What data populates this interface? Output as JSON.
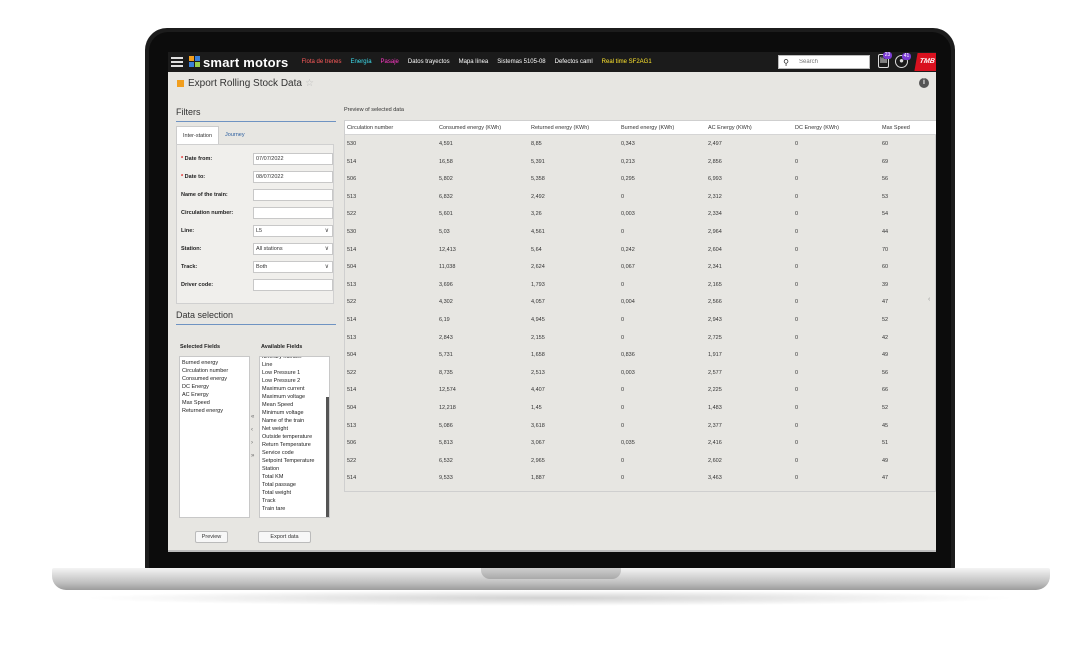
{
  "nav": {
    "logo_text": "smart motors",
    "items": [
      {
        "label": "Flota de trenes",
        "color": "#ff5b5b",
        "bar": ""
      },
      {
        "label": "Energía",
        "color": "#3ee0f0",
        "bar": ""
      },
      {
        "label": "Pasaje",
        "color": "#ff39c7",
        "bar": ""
      },
      {
        "label": "Datos trayectos",
        "color": "#ffffff",
        "bar": "#d63b3b"
      },
      {
        "label": "Mapa línea",
        "color": "#ffffff",
        "bar": ""
      },
      {
        "label": "Sistemas 5105-08",
        "color": "#ffffff",
        "bar": ""
      },
      {
        "label": "Defectos caml",
        "color": "#ffffff",
        "bar": "#9a9a9a"
      },
      {
        "label": "Real time SF2AG1",
        "color": "#ffe62e",
        "bar": "#ffe62e"
      }
    ],
    "search_placeholder": "Search",
    "badge_1": "23",
    "badge_2": "41",
    "brand_mark": "TMB"
  },
  "page": {
    "title": "Export Rolling Stock Data",
    "info_icon": "i"
  },
  "filters": {
    "heading": "Filters",
    "tabs": [
      "Inter-station",
      "Journey"
    ],
    "fields": [
      {
        "label": "Date from:",
        "required": true,
        "value": "07/07/2022",
        "dropdown": false
      },
      {
        "label": "Date to:",
        "required": true,
        "value": "08/07/2022",
        "dropdown": false
      },
      {
        "label": "Name of the train:",
        "required": false,
        "value": "",
        "dropdown": false
      },
      {
        "label": "Circulation number:",
        "required": false,
        "value": "",
        "dropdown": false
      },
      {
        "label": "Line:",
        "required": false,
        "value": "L5",
        "dropdown": true
      },
      {
        "label": "Station:",
        "required": false,
        "value": "All stations",
        "dropdown": true
      },
      {
        "label": "Track:",
        "required": false,
        "value": "Both",
        "dropdown": true
      },
      {
        "label": "Driver code:",
        "required": false,
        "value": "",
        "dropdown": false
      }
    ]
  },
  "data_selection": {
    "heading": "Data selection",
    "selected_title": "Selected Fields",
    "available_title": "Available Fields",
    "selected": [
      "Burned energy",
      "Circulation number",
      "Consumed energy",
      "DC Energy",
      "AC Energy",
      "Max Speed",
      "Returned energy"
    ],
    "available": [
      "Itinerary number",
      "Line",
      "Low Pressure 1",
      "Low Pressure 2",
      "Maximum current",
      "Maximum voltage",
      "Mean Speed",
      "Minimum voltage",
      "Name of the train",
      "Net weight",
      "Outside temperature",
      "Return Temperature",
      "Service code",
      "Setpoint Temperature",
      "Station",
      "Total KM",
      "Total passage",
      "Total weight",
      "Track",
      "Train tare"
    ],
    "arrows": [
      "«",
      "‹",
      "›",
      "»"
    ],
    "preview_button": "Preview",
    "export_button": "Export data"
  },
  "preview": {
    "label": "Preview of selected data",
    "columns": [
      "Circulation number",
      "Consumed energy (KWh)",
      "Returned energy (KWh)",
      "Burned energy (KWh)",
      "AC Energy (KWh)",
      "DC Energy (KWh)",
      "Max Speed"
    ],
    "rows": [
      [
        "530",
        "4,591",
        "8,85",
        "0,343",
        "2,497",
        "0",
        "60"
      ],
      [
        "514",
        "16,58",
        "5,391",
        "0,213",
        "2,856",
        "0",
        "69"
      ],
      [
        "506",
        "5,802",
        "5,358",
        "0,295",
        "6,993",
        "0",
        "56"
      ],
      [
        "513",
        "6,832",
        "2,492",
        "0",
        "2,312",
        "0",
        "53"
      ],
      [
        "522",
        "5,601",
        "3,26",
        "0,003",
        "2,334",
        "0",
        "54"
      ],
      [
        "530",
        "5,03",
        "4,561",
        "0",
        "2,964",
        "0",
        "44"
      ],
      [
        "514",
        "12,413",
        "5,64",
        "0,242",
        "2,604",
        "0",
        "70"
      ],
      [
        "504",
        "11,038",
        "2,624",
        "0,067",
        "2,341",
        "0",
        "60"
      ],
      [
        "513",
        "3,696",
        "1,793",
        "0",
        "2,165",
        "0",
        "39"
      ],
      [
        "522",
        "4,302",
        "4,057",
        "0,004",
        "2,566",
        "0",
        "47"
      ],
      [
        "514",
        "6,19",
        "4,945",
        "0",
        "2,943",
        "0",
        "52"
      ],
      [
        "513",
        "2,843",
        "2,155",
        "0",
        "2,725",
        "0",
        "42"
      ],
      [
        "504",
        "5,731",
        "1,658",
        "0,836",
        "1,917",
        "0",
        "49"
      ],
      [
        "522",
        "8,735",
        "2,513",
        "0,003",
        "2,577",
        "0",
        "56"
      ],
      [
        "514",
        "12,574",
        "4,407",
        "0",
        "2,225",
        "0",
        "66"
      ],
      [
        "504",
        "12,218",
        "1,45",
        "0",
        "1,483",
        "0",
        "52"
      ],
      [
        "513",
        "5,086",
        "3,618",
        "0",
        "2,377",
        "0",
        "45"
      ],
      [
        "506",
        "5,813",
        "3,067",
        "0,035",
        "2,416",
        "0",
        "51"
      ],
      [
        "522",
        "6,532",
        "2,965",
        "0",
        "2,602",
        "0",
        "49"
      ],
      [
        "514",
        "9,533",
        "1,887",
        "0",
        "3,463",
        "0",
        "47"
      ]
    ]
  }
}
